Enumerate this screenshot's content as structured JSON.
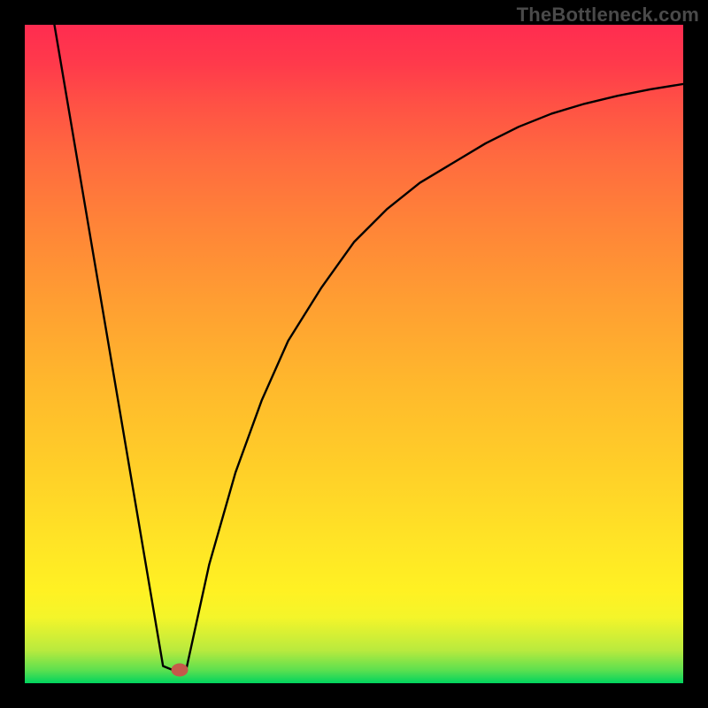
{
  "watermark": "TheBottleneck.com",
  "chart_data": {
    "type": "line",
    "title": "",
    "xlabel": "",
    "ylabel": "",
    "xlim": [
      0,
      100
    ],
    "ylim": [
      0,
      100
    ],
    "grid": false,
    "legend": false,
    "annotations": [],
    "series": [
      {
        "name": "curve-left",
        "x": [
          4.5,
          21.0,
          22.5
        ],
        "y": [
          100,
          2.6,
          2.0
        ]
      },
      {
        "name": "curve-floor",
        "x": [
          22.5,
          24.5
        ],
        "y": [
          2.0,
          2.0
        ]
      },
      {
        "name": "curve-right",
        "x": [
          24.5,
          28,
          32,
          36,
          40,
          45,
          50,
          55,
          60,
          65,
          70,
          75,
          80,
          85,
          90,
          95,
          100
        ],
        "y": [
          2.0,
          18,
          32,
          43,
          52,
          60,
          67,
          72,
          76,
          79,
          82,
          84.5,
          86.5,
          88,
          89.2,
          90.2,
          91
        ]
      }
    ],
    "marker": {
      "x": 23.5,
      "y": 2.0,
      "color": "#c55a4a"
    },
    "background_gradient": {
      "direction": "bottom-to-top",
      "stops": [
        {
          "pos": 0.0,
          "color": "#00d45e"
        },
        {
          "pos": 0.1,
          "color": "#f4f52a"
        },
        {
          "pos": 0.5,
          "color": "#ffb92c"
        },
        {
          "pos": 1.0,
          "color": "#ff2c50"
        }
      ]
    }
  },
  "colors": {
    "frame": "#000000",
    "curve": "#000000",
    "marker": "#c55a4a",
    "watermark": "#4a4a4a"
  }
}
